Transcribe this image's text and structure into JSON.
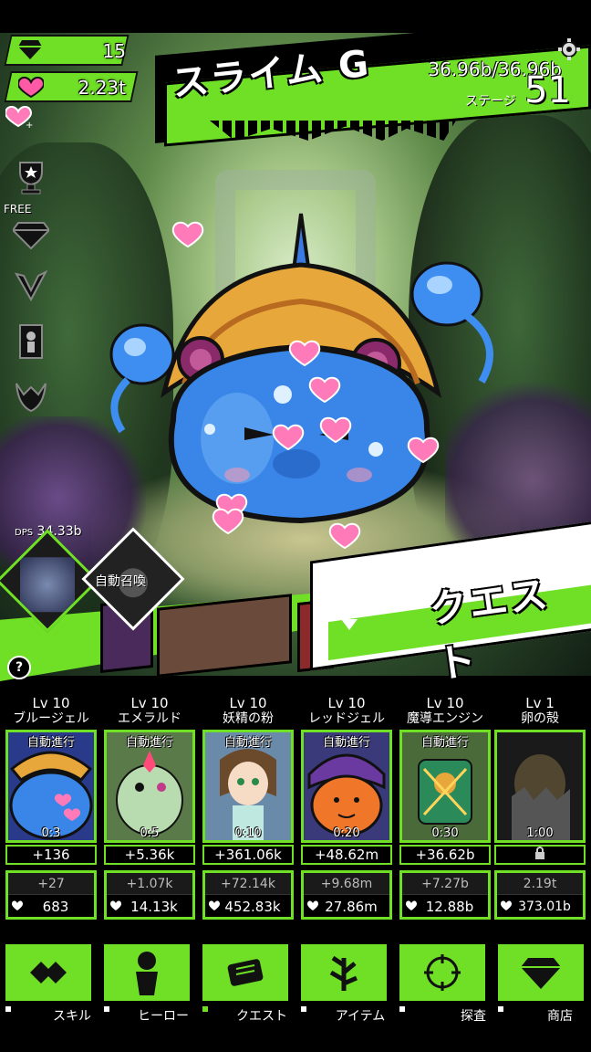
{
  "hud": {
    "gems": "15",
    "hearts": "2.23t"
  },
  "monster": {
    "name": "スライム G",
    "hp": "36.96b/36.96b",
    "stage_label": "ステージ",
    "stage": "51"
  },
  "side": {
    "free_label": "FREE"
  },
  "dps": {
    "label": "DPS",
    "value": "34.33b"
  },
  "auto_summon": "自動召喚",
  "quest": "クエスト",
  "help": "?",
  "heroes": [
    {
      "lv": "Lv 10",
      "name": "ブルージェル",
      "auto": "自動進行",
      "timer": "0:3",
      "power": "+136",
      "upgrade": "+27",
      "cost": "683"
    },
    {
      "lv": "Lv 10",
      "name": "エメラルド",
      "auto": "自動進行",
      "timer": "0:5",
      "power": "+5.36k",
      "upgrade": "+1.07k",
      "cost": "14.13k"
    },
    {
      "lv": "Lv 10",
      "name": "妖精の粉",
      "auto": "自動進行",
      "timer": "0:10",
      "power": "+361.06k",
      "upgrade": "+72.14k",
      "cost": "452.83k"
    },
    {
      "lv": "Lv 10",
      "name": "レッドジェル",
      "auto": "自動進行",
      "timer": "0:20",
      "power": "+48.62m",
      "upgrade": "+9.68m",
      "cost": "27.86m"
    },
    {
      "lv": "Lv 10",
      "name": "魔導エンジン",
      "auto": "自動進行",
      "timer": "0:30",
      "power": "+36.62b",
      "upgrade": "+7.27b",
      "cost": "12.88b"
    },
    {
      "lv": "Lv 1",
      "name": "卵の殻",
      "auto": "",
      "timer": "1:00",
      "power": "",
      "upgrade": "2.19t",
      "cost": "373.01b"
    }
  ],
  "nav": {
    "skill": "スキル",
    "hero": "ヒーロー",
    "quest": "クエスト",
    "item": "アイテム",
    "explore": "探査",
    "shop": "商店"
  },
  "colors": {
    "accent": "#6fe026",
    "background": "#000000"
  }
}
